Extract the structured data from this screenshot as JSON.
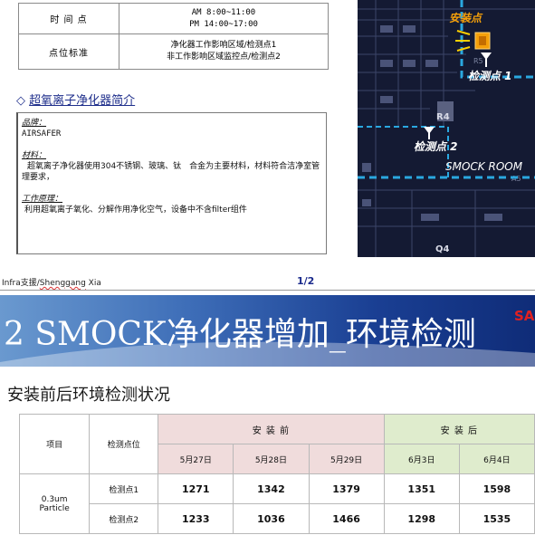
{
  "info_table": {
    "rows": [
      {
        "label": "时 间 点",
        "lines": [
          "AM 8:00~11:00",
          "PM 14:00~17:00"
        ]
      },
      {
        "label": "点位标准",
        "lines": [
          "净化器工作影响区域/检测点1",
          "非工作影响区域监控点/检测点2"
        ]
      }
    ]
  },
  "intro": {
    "marker": "◇",
    "heading": "超氧离子净化器简介",
    "brand_label": "品牌：",
    "brand_value": "AIRSAFER",
    "material_label": "材料：",
    "material_text": "超氧离子净化器使用304不锈钢、玻璃、钛　合金为主要材料，材料符合洁净室管理要求，",
    "principle_label": "工作原理：",
    "principle_text": "利用超氧离子氧化、分解作用净化空气，设备中不含filter组件"
  },
  "map": {
    "install_label": "安装点",
    "point1_label": "检测点 1",
    "point2_label": "检测点 2",
    "room_label": "SMOCK ROOM",
    "tag_r4": "R4",
    "tag_q4": "Q4",
    "tag_r5": "R5",
    "tag_a5": "A5",
    "colors": {
      "background": "#141a33",
      "dashed_border": "#2aa8e0",
      "install": "#f5a00a"
    }
  },
  "footer": {
    "author_prefix": "Infra支援/",
    "author_name": "Shenggang",
    "author_suffix": "  Xia",
    "page": "1/2"
  },
  "banner": {
    "title": "2 SMOCK净化器增加_环境检测",
    "brand": "SA"
  },
  "section_title": "安装前后环境检测状况",
  "data_table": {
    "col_item": "项目",
    "col_point": "检测点位",
    "group_before": "安 装 前",
    "group_after": "安 装 后",
    "dates": [
      "5月27日",
      "5月28日",
      "5月29日",
      "6月3日",
      "6月4日"
    ],
    "item_line1": "0.3um",
    "item_line2": "Particle",
    "rows": [
      {
        "point": "检测点1",
        "values": [
          "1271",
          "1342",
          "1379",
          "1351",
          "1598"
        ]
      },
      {
        "point": "检测点2",
        "values": [
          "1233",
          "1036",
          "1466",
          "1298",
          "1535"
        ]
      }
    ]
  }
}
